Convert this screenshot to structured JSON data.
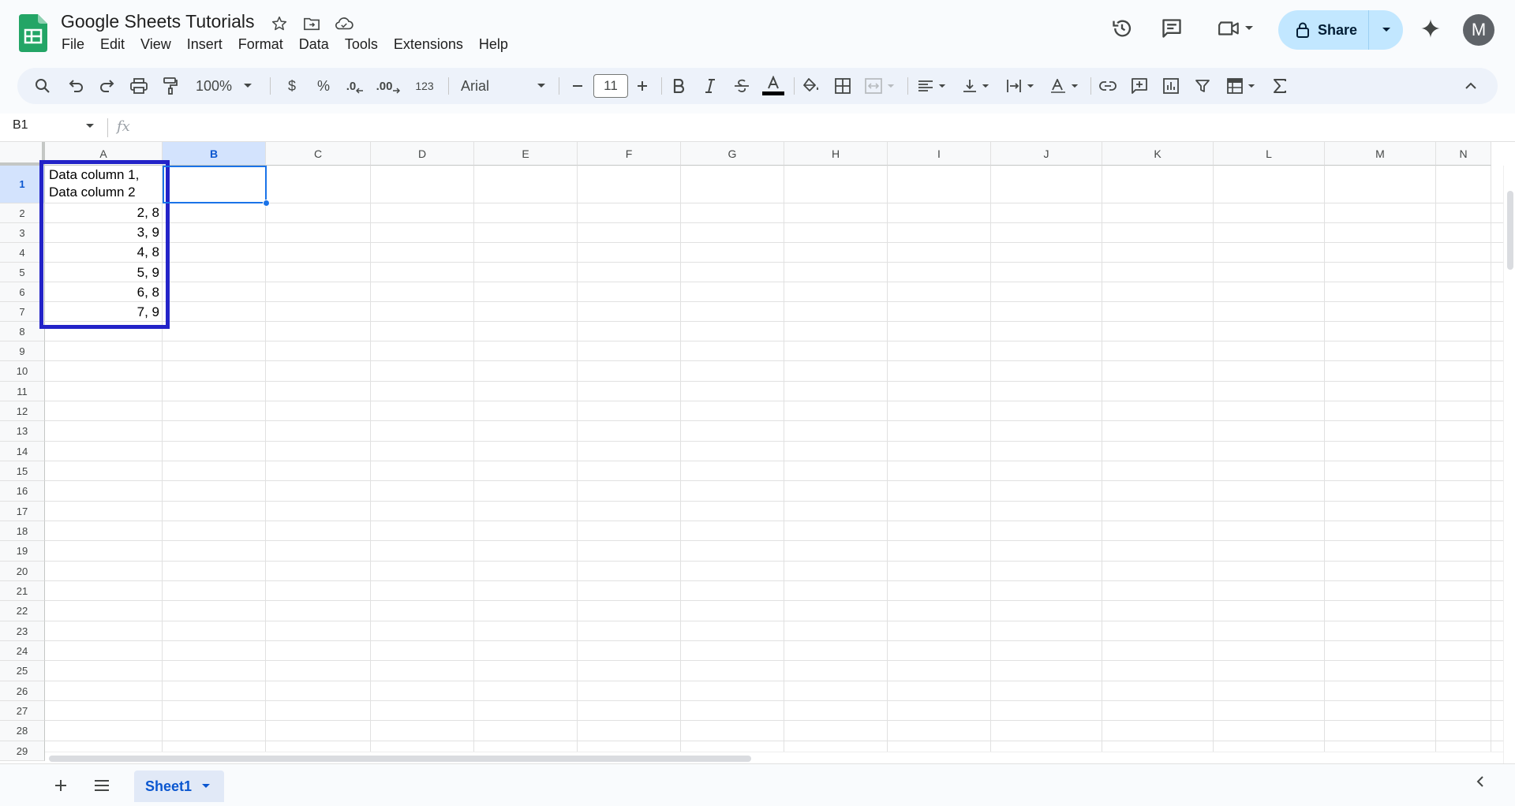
{
  "doc": {
    "title": "Google Sheets Tutorials"
  },
  "menu": [
    "File",
    "Edit",
    "View",
    "Insert",
    "Format",
    "Data",
    "Tools",
    "Extensions",
    "Help"
  ],
  "share": {
    "label": "Share"
  },
  "avatar": {
    "initial": "M"
  },
  "toolbar": {
    "zoom": "100%",
    "currency": "$",
    "percent": "%",
    "dec_decrease": ".0",
    "dec_increase": ".00",
    "number_format": "123",
    "font": "Arial",
    "font_size": "11"
  },
  "formula_bar": {
    "name_box": "B1",
    "fx": "fx"
  },
  "grid": {
    "columns": [
      "A",
      "B",
      "C",
      "D",
      "E",
      "F",
      "G",
      "H",
      "I",
      "J",
      "K",
      "L",
      "M",
      "N"
    ],
    "selected_column": "B",
    "rows": [
      "1",
      "2",
      "3",
      "4",
      "5",
      "6",
      "7",
      "8",
      "9",
      "10",
      "11",
      "12",
      "13",
      "14",
      "15",
      "16",
      "17",
      "18",
      "19",
      "20",
      "21",
      "22",
      "23",
      "24",
      "25",
      "26",
      "27",
      "28",
      "29"
    ],
    "selected_row": "1",
    "cells": {
      "A1_line1": "Data column 1,",
      "A1_line2": "Data column 2",
      "A2": "2, 8",
      "A3": "3, 9",
      "A4": "4, 8",
      "A5": "5, 9",
      "A6": "6, 8",
      "A7": "7, 9"
    },
    "highlight_color": "#2323c8",
    "selection_color": "#1a73e8"
  },
  "sheets": [
    {
      "label": "Sheet1",
      "active": true
    }
  ]
}
